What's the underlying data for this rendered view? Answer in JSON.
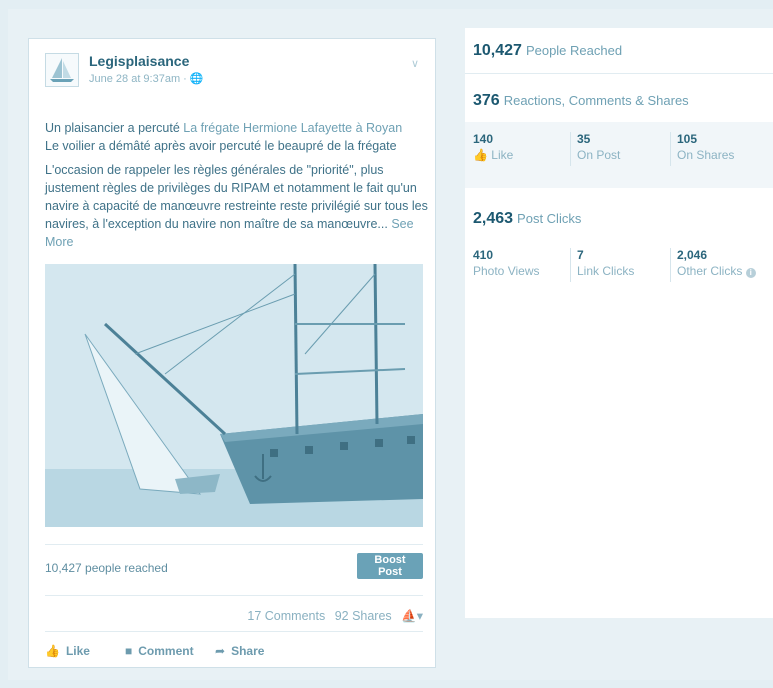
{
  "post": {
    "page_name": "Legisplaisance",
    "date": "June 28 at 9:37am ·",
    "text_line1_prefix": "Un plaisancier a percuté ",
    "text_line1_link": "La frégate Hermione Lafayette à Royan",
    "text_line2": "Le voilier a démâté après avoir percuté le beaupré de la frégate",
    "text_para2": "L'occasion de rappeler les règles générales de \"priorité\", plus justement règles de privilèges du RIPAM et notamment le fait qu'un navire à capacité de manœuvre restreinte reste privilégié sur tous les navires, à l'exception du navire non maître de sa manœuvre...",
    "see_more": "See More",
    "people_reached": "10,427 people reached",
    "boost_label": "Boost Post",
    "comments": "17 Comments",
    "shares": "92 Shares",
    "actions": {
      "like": "Like",
      "comment": "Comment",
      "share": "Share"
    }
  },
  "insights": {
    "reached_num": "10,427",
    "reached_lbl": "People Reached",
    "reactions_num": "376",
    "reactions_lbl": "Reactions, Comments & Shares",
    "reaction_stats": [
      {
        "num": "140",
        "lbl": "Like"
      },
      {
        "num": "35",
        "lbl": "On Post"
      },
      {
        "num": "105",
        "lbl": "On Shares"
      }
    ],
    "clicks_num": "2,463",
    "clicks_lbl": "Post Clicks",
    "click_stats": [
      {
        "num": "410",
        "lbl": "Photo Views"
      },
      {
        "num": "7",
        "lbl": "Link Clicks"
      },
      {
        "num": "2,046",
        "lbl": "Other Clicks"
      }
    ]
  },
  "colors": {
    "accent": "#6aa2b7",
    "text_dark": "#1c5870",
    "text_light": "#8cb3c3",
    "background": "#e3eef3"
  },
  "icons": [
    "sailboat-logo",
    "globe-icon",
    "chevron-down-icon",
    "like-icon",
    "comment-icon",
    "share-icon",
    "info-icon"
  ]
}
